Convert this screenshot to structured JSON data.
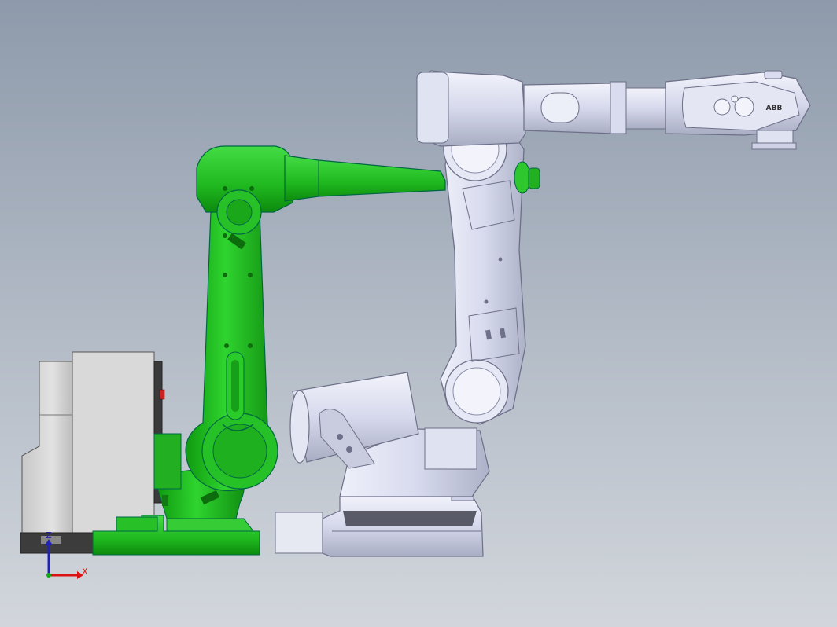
{
  "view": {
    "background_top": "#8e9aab",
    "background_bottom": "#d2d6dc"
  },
  "robot_left": {
    "color": "#1fc41f",
    "color_dark": "#0d7d0d"
  },
  "robot_right": {
    "color": "#d8dbee",
    "color_dark": "#8a8ea8",
    "logo": "ABB"
  },
  "controller": {
    "color": "#d6d6d6"
  },
  "triad": {
    "x_label": "X",
    "z_label": "Z",
    "x_color": "#d11",
    "z_color": "#22b",
    "y_color": "#1a1"
  }
}
